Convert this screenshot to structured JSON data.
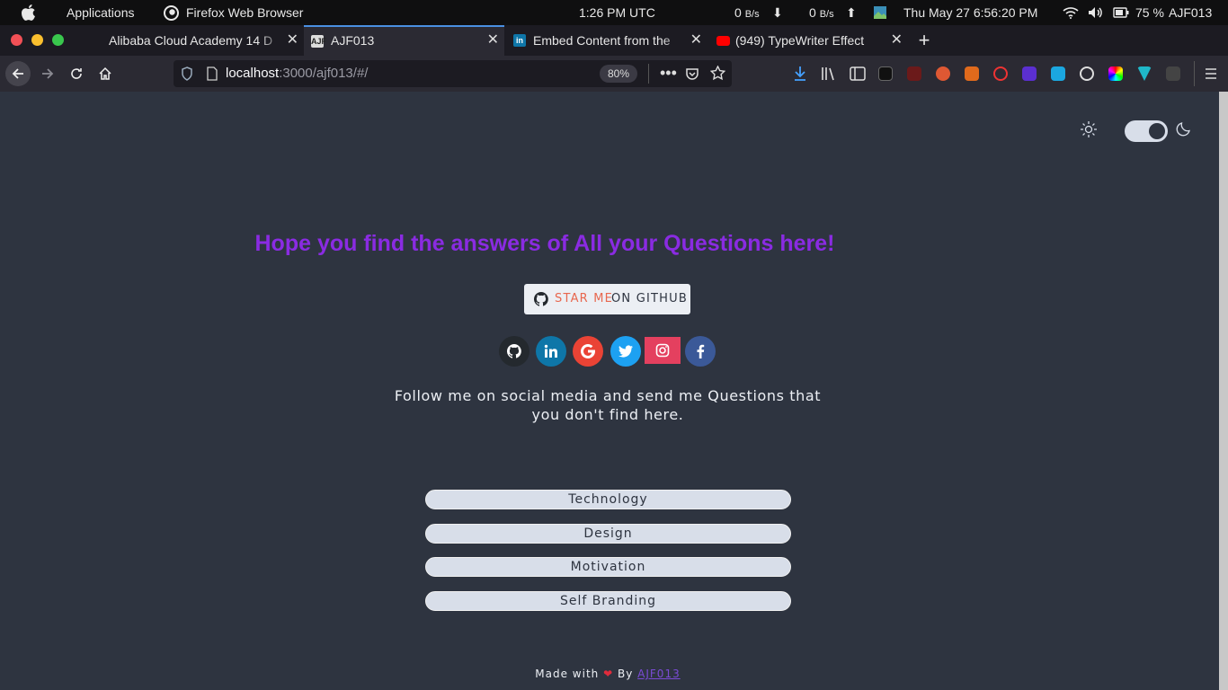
{
  "os_bar": {
    "menu": "Applications",
    "app": "Firefox Web Browser",
    "clock": "1:26 PM UTC",
    "net_down": "0",
    "net_down_unit": "B/s",
    "net_up": "0",
    "net_up_unit": "B/s",
    "datetime": "Thu May 27   6:56:20 PM",
    "battery": "75 %",
    "user": "AJF013"
  },
  "tabs": [
    {
      "title": "Alibaba Cloud Academy 14 D",
      "active": false
    },
    {
      "title": "AJF013",
      "active": true,
      "icon": "AJF"
    },
    {
      "title": "Embed Content from the",
      "active": false,
      "icon": "in"
    },
    {
      "title": "(949) TypeWriter Effect",
      "active": false
    }
  ],
  "navigation": {
    "url_host": "localhost",
    "url_rest": ":3000/ajf013/#/",
    "zoom": "80%"
  },
  "page": {
    "headline": "Hope you find the answers of All your Questions here!",
    "star_button": {
      "part1": "STAR ME",
      "part2": "ON GITHUB"
    },
    "social_icons": [
      "github-icon",
      "linkedin-icon",
      "google-icon",
      "twitter-icon",
      "instagram-icon",
      "facebook-icon"
    ],
    "follow_text": {
      "line1": "Follow me on social media and send me Questions that",
      "line2": "you don't find here."
    },
    "categories": [
      "Technology",
      "Design",
      "Motivation",
      "Self Branding"
    ],
    "footer": {
      "made_with": "Made with",
      "by": "By",
      "author": "AJF013"
    }
  },
  "colors": {
    "background": "#2e3440",
    "headline": "#8a2be2",
    "github": "#24292e",
    "linkedin": "#0e76a8",
    "google": "#ea4335",
    "twitter": "#1da1f2",
    "instagram": "#e4405f",
    "facebook": "#3b5998"
  }
}
